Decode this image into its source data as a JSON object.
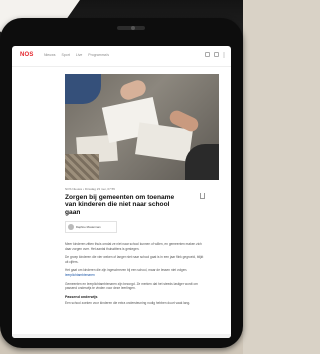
{
  "app": {
    "logo": "NOS"
  },
  "nav": {
    "links": [
      "Nieuws",
      "Sport",
      "Live",
      "Programma's"
    ]
  },
  "article": {
    "meta": "NOS Nieuws • Dinsdag 23 mei, 07:55",
    "title": "Zorgen bij gemeenten om toename van kinderen die niet naar school gaan",
    "author": "Daphne Mosterman",
    "paragraphs": [
      "Meer kinderen zitten thuis omdat ze niet naar school kunnen of willen, en gemeenten maken zich daar zorgen over. Het aantal thuiszitters is gestegen.",
      "De groep kinderen die vier weken of langer niet naar school gaat is in een jaar flink gegroeid, blijkt uit cijfers.",
      "Het gaat om kinderen die zijn ingeschreven bij een school, maar de lessen niet volgen.",
      "Gemeenten en leerplichtambtenaren zijn bezorgd. Ze merken dat het steeds lastiger wordt om passend onderwijs te vinden voor deze leerlingen."
    ],
    "link_text": "leerplichtambtenaren",
    "subhead": "Passend onderwijs",
    "last_paragraph": "Een school zoeken voor kinderen die extra ondersteuning nodig hebben duurt vaak lang."
  },
  "colors": {
    "brand": "#e4272e",
    "link": "#1a56a8"
  }
}
